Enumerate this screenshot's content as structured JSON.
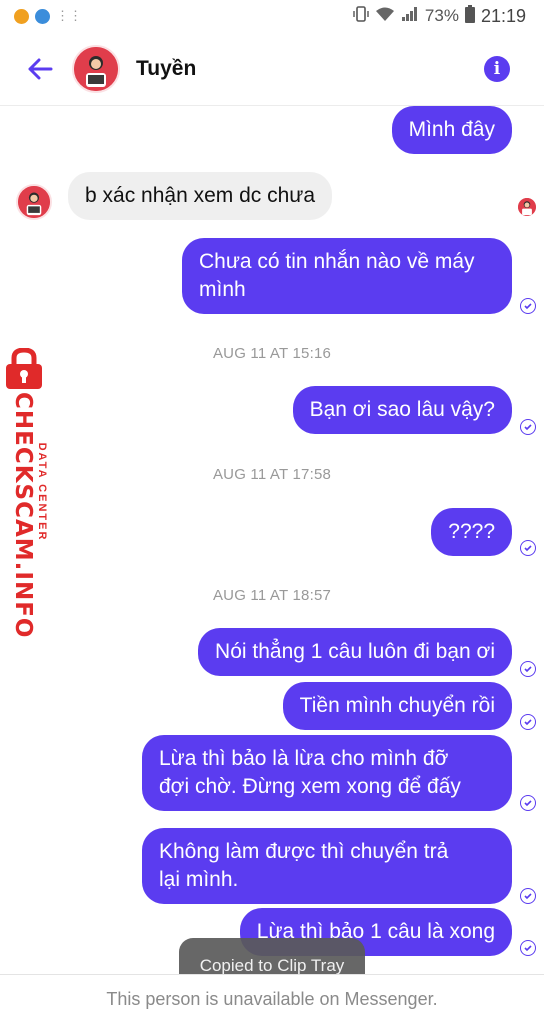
{
  "status_bar": {
    "battery": "73%",
    "time": "21:19"
  },
  "header": {
    "contact_name": "Tuyền",
    "back_icon": "arrow-left-icon",
    "info_icon": "info-icon",
    "info_glyph": "i"
  },
  "messages": {
    "m1": "Mình đây",
    "m2": "b xác nhận xem dc chưa",
    "m3_line1": "Chưa có tin nhắn nào về máy",
    "m3_line2": "mình",
    "ts1": "AUG 11 AT 15:16",
    "m4": "Bạn ơi sao lâu vậy?",
    "ts2": "AUG 11 AT 17:58",
    "m5": "????",
    "ts3": "AUG 11 AT 18:57",
    "m6": "Nói thẳng 1 câu luôn đi bạn ơi",
    "m7": "Tiền mình chuyển rồi",
    "m8_line1": "Lừa thì bảo là lừa cho mình đỡ",
    "m8_line2": "đợi chờ. Đừng xem xong để đấy",
    "m9_line1": "Không làm được thì chuyển trả",
    "m9_line2": "lại mình.",
    "m10": "Lừa thì bảo 1 câu là xong"
  },
  "watermark": {
    "main": "CHECKSCAM.INFO",
    "sub": "DATA CENTER"
  },
  "toast": "Copied to Clip Tray",
  "footer": "This person is unavailable on Messenger.",
  "colors": {
    "accent": "#5b3cf0",
    "incoming_bubble": "#efefef",
    "watermark_red": "#e02a2a"
  }
}
